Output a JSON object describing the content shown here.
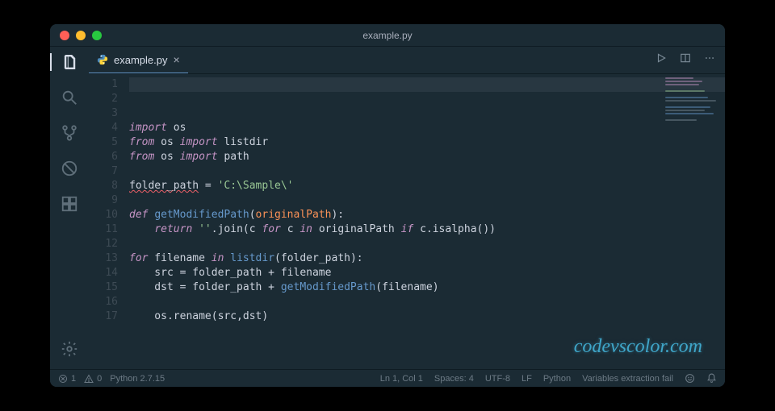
{
  "title": "example.py",
  "tab": {
    "filename": "example.py",
    "icon": "python-file-icon"
  },
  "editor": {
    "line_numbers": "1\n2\n3\n4\n5\n6\n7\n8\n9\n10\n11\n12\n13\n14\n15\n16\n17",
    "code": {
      "l1_kw": "import",
      "l1_mod": " os",
      "l2_a": "from",
      "l2_b": " os ",
      "l2_c": "import",
      "l2_d": " listdir",
      "l3_a": "from",
      "l3_b": " os ",
      "l3_c": "import",
      "l3_d": " path",
      "l5_a": "folder_path",
      "l5_b": " = ",
      "l5_c": "'C:\\Sample\\'",
      "l7_a": "def ",
      "l7_b": "getModifiedPath",
      "l7_c": "(",
      "l7_d": "originalPath",
      "l7_e": "):",
      "l8_a": "    ",
      "l8_b": "return",
      "l8_c": " ",
      "l8_d": "''",
      "l8_e": ".join(c ",
      "l8_f": "for",
      "l8_g": " c ",
      "l8_h": "in",
      "l8_i": " originalPath ",
      "l8_j": "if",
      "l8_k": " c.isalpha())",
      "l10_a": "for",
      "l10_b": " filename ",
      "l10_c": "in",
      "l10_d": " ",
      "l10_e": "listdir",
      "l10_f": "(folder_path):",
      "l11_a": "    src = folder_path + filename",
      "l12_a": "    dst = folder_path + ",
      "l12_b": "getModifiedPath",
      "l12_c": "(filename)",
      "l14_a": "    os.rename(src,dst)"
    }
  },
  "status": {
    "errors": "1",
    "warnings": "0",
    "python_version": "Python 2.7.15",
    "cursor": "Ln 1, Col 1",
    "spaces": "Spaces: 4",
    "encoding": "UTF-8",
    "eol": "LF",
    "language": "Python",
    "extra": "Variables extraction fail"
  },
  "watermark": "codevscolor.com"
}
